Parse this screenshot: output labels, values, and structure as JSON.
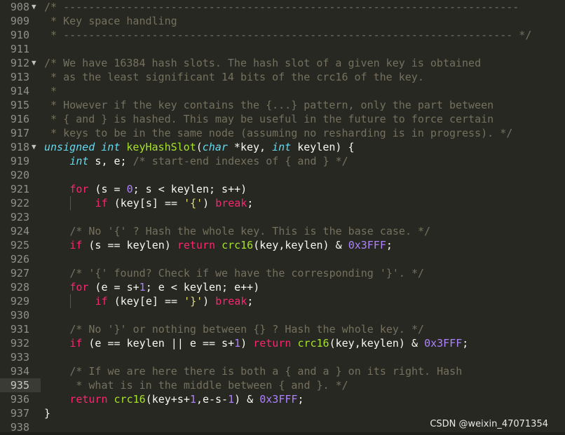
{
  "editor": {
    "lines": [
      {
        "num": "908",
        "fold": true,
        "indent": 0,
        "tokens": [
          {
            "t": "/* ------------------------------------------------------------------------",
            "c": "comment"
          }
        ]
      },
      {
        "num": "909",
        "fold": false,
        "indent": 0,
        "tokens": [
          {
            "t": " * Key space handling",
            "c": "comment"
          }
        ]
      },
      {
        "num": "910",
        "fold": false,
        "indent": 0,
        "tokens": [
          {
            "t": " * ----------------------------------------------------------------------- */",
            "c": "comment"
          }
        ]
      },
      {
        "num": "911",
        "fold": false,
        "indent": 0,
        "tokens": []
      },
      {
        "num": "912",
        "fold": true,
        "indent": 0,
        "tokens": [
          {
            "t": "/* We have 16384 hash slots. The hash slot of a given key is obtained",
            "c": "comment"
          }
        ]
      },
      {
        "num": "913",
        "fold": false,
        "indent": 0,
        "tokens": [
          {
            "t": " * as the least significant 14 bits of the crc16 of the key.",
            "c": "comment"
          }
        ]
      },
      {
        "num": "914",
        "fold": false,
        "indent": 0,
        "tokens": [
          {
            "t": " *",
            "c": "comment"
          }
        ]
      },
      {
        "num": "915",
        "fold": false,
        "indent": 0,
        "tokens": [
          {
            "t": " * However if the key contains the {...} pattern, only the part between",
            "c": "comment"
          }
        ]
      },
      {
        "num": "916",
        "fold": false,
        "indent": 0,
        "tokens": [
          {
            "t": " * { and } is hashed. This may be useful in the future to force certain",
            "c": "comment"
          }
        ]
      },
      {
        "num": "917",
        "fold": false,
        "indent": 0,
        "tokens": [
          {
            "t": " * keys to be in the same node (assuming no resharding is in progress). */",
            "c": "comment"
          }
        ]
      },
      {
        "num": "918",
        "fold": true,
        "indent": 0,
        "tokens": [
          {
            "t": "unsigned int",
            "c": "type"
          },
          {
            "t": " ",
            "c": "plain"
          },
          {
            "t": "keyHashSlot",
            "c": "func"
          },
          {
            "t": "(",
            "c": "plain"
          },
          {
            "t": "char",
            "c": "type"
          },
          {
            "t": " *key, ",
            "c": "plain"
          },
          {
            "t": "int",
            "c": "type"
          },
          {
            "t": " keylen) {",
            "c": "plain"
          }
        ]
      },
      {
        "num": "919",
        "fold": false,
        "indent": 1,
        "tokens": [
          {
            "t": "int",
            "c": "type"
          },
          {
            "t": " s, e; ",
            "c": "plain"
          },
          {
            "t": "/* start-end indexes of { and } */",
            "c": "comment"
          }
        ]
      },
      {
        "num": "920",
        "fold": false,
        "indent": 0,
        "tokens": []
      },
      {
        "num": "921",
        "fold": false,
        "indent": 1,
        "tokens": [
          {
            "t": "for",
            "c": "keyword"
          },
          {
            "t": " (s = ",
            "c": "plain"
          },
          {
            "t": "0",
            "c": "number"
          },
          {
            "t": "; s < keylen; s++)",
            "c": "plain"
          }
        ]
      },
      {
        "num": "922",
        "fold": false,
        "indent": 2,
        "tokens": [
          {
            "t": "if",
            "c": "keyword"
          },
          {
            "t": " (key[s] == ",
            "c": "plain"
          },
          {
            "t": "'{'",
            "c": "string"
          },
          {
            "t": ") ",
            "c": "plain"
          },
          {
            "t": "break",
            "c": "keyword"
          },
          {
            "t": ";",
            "c": "plain"
          }
        ]
      },
      {
        "num": "923",
        "fold": false,
        "indent": 0,
        "tokens": []
      },
      {
        "num": "924",
        "fold": false,
        "indent": 1,
        "tokens": [
          {
            "t": "/* No '{' ? Hash the whole key. This is the base case. */",
            "c": "comment"
          }
        ]
      },
      {
        "num": "925",
        "fold": false,
        "indent": 1,
        "tokens": [
          {
            "t": "if",
            "c": "keyword"
          },
          {
            "t": " (s == keylen) ",
            "c": "plain"
          },
          {
            "t": "return",
            "c": "keyword"
          },
          {
            "t": " ",
            "c": "plain"
          },
          {
            "t": "crc16",
            "c": "func"
          },
          {
            "t": "(key,keylen) & ",
            "c": "plain"
          },
          {
            "t": "0x3FFF",
            "c": "number"
          },
          {
            "t": ";",
            "c": "plain"
          }
        ]
      },
      {
        "num": "926",
        "fold": false,
        "indent": 0,
        "tokens": []
      },
      {
        "num": "927",
        "fold": false,
        "indent": 1,
        "tokens": [
          {
            "t": "/* '{' found? Check if we have the corresponding '}'. */",
            "c": "comment"
          }
        ]
      },
      {
        "num": "928",
        "fold": false,
        "indent": 1,
        "tokens": [
          {
            "t": "for",
            "c": "keyword"
          },
          {
            "t": " (e = s+",
            "c": "plain"
          },
          {
            "t": "1",
            "c": "number"
          },
          {
            "t": "; e < keylen; e++)",
            "c": "plain"
          }
        ]
      },
      {
        "num": "929",
        "fold": false,
        "indent": 2,
        "tokens": [
          {
            "t": "if",
            "c": "keyword"
          },
          {
            "t": " (key[e] == ",
            "c": "plain"
          },
          {
            "t": "'}'",
            "c": "string"
          },
          {
            "t": ") ",
            "c": "plain"
          },
          {
            "t": "break",
            "c": "keyword"
          },
          {
            "t": ";",
            "c": "plain"
          }
        ]
      },
      {
        "num": "930",
        "fold": false,
        "indent": 0,
        "tokens": []
      },
      {
        "num": "931",
        "fold": false,
        "indent": 1,
        "tokens": [
          {
            "t": "/* No '}' or nothing between {} ? Hash the whole key. */",
            "c": "comment"
          }
        ]
      },
      {
        "num": "932",
        "fold": false,
        "indent": 1,
        "tokens": [
          {
            "t": "if",
            "c": "keyword"
          },
          {
            "t": " (e == keylen || e == s+",
            "c": "plain"
          },
          {
            "t": "1",
            "c": "number"
          },
          {
            "t": ") ",
            "c": "plain"
          },
          {
            "t": "return",
            "c": "keyword"
          },
          {
            "t": " ",
            "c": "plain"
          },
          {
            "t": "crc16",
            "c": "func"
          },
          {
            "t": "(key,keylen) & ",
            "c": "plain"
          },
          {
            "t": "0x3FFF",
            "c": "number"
          },
          {
            "t": ";",
            "c": "plain"
          }
        ]
      },
      {
        "num": "933",
        "fold": false,
        "indent": 0,
        "tokens": []
      },
      {
        "num": "934",
        "fold": false,
        "indent": 1,
        "tokens": [
          {
            "t": "/* If we are here there is both a { and a } on its right. Hash",
            "c": "comment"
          }
        ]
      },
      {
        "num": "935",
        "fold": false,
        "indent": 1,
        "current": true,
        "tokens": [
          {
            "t": " * what is in the middle between { and }. */",
            "c": "comment"
          }
        ]
      },
      {
        "num": "936",
        "fold": false,
        "indent": 1,
        "tokens": [
          {
            "t": "return",
            "c": "keyword"
          },
          {
            "t": " ",
            "c": "plain"
          },
          {
            "t": "crc16",
            "c": "func"
          },
          {
            "t": "(key+s+",
            "c": "plain"
          },
          {
            "t": "1",
            "c": "number"
          },
          {
            "t": ",e-s-",
            "c": "plain"
          },
          {
            "t": "1",
            "c": "number"
          },
          {
            "t": ") & ",
            "c": "plain"
          },
          {
            "t": "0x3FFF",
            "c": "number"
          },
          {
            "t": ";",
            "c": "plain"
          }
        ]
      },
      {
        "num": "937",
        "fold": false,
        "indent": 0,
        "tokens": [
          {
            "t": "}",
            "c": "plain"
          }
        ]
      },
      {
        "num": "938",
        "fold": false,
        "indent": 0,
        "tokens": []
      }
    ]
  },
  "watermark": "CSDN @weixin_47071354",
  "colors": {
    "background": "#272822",
    "comment": "#75715e",
    "keyword": "#f92672",
    "type": "#66d9ef",
    "function": "#a6e22e",
    "number": "#ae81ff",
    "string": "#e6db74"
  }
}
